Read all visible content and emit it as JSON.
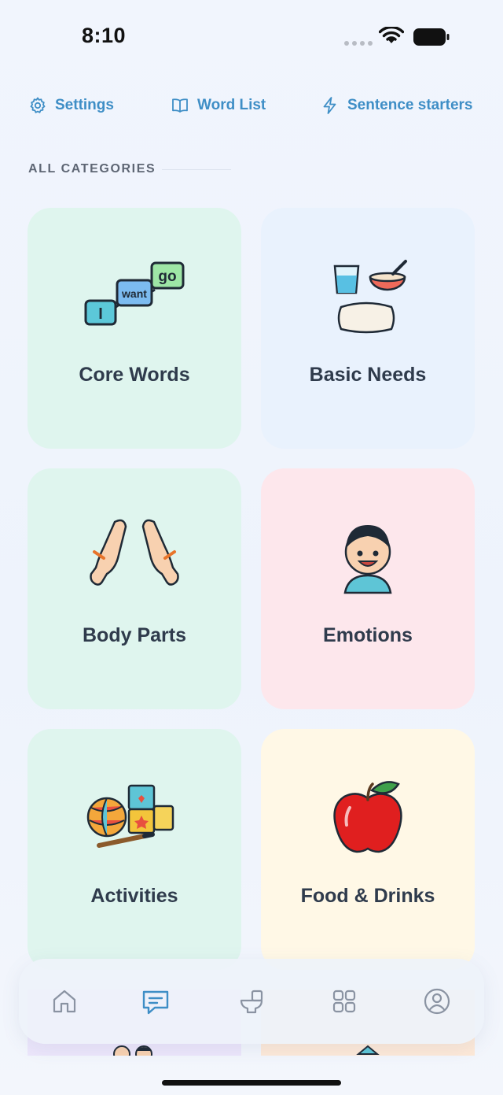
{
  "status": {
    "time": "8:10"
  },
  "toolbar": {
    "settings": {
      "label": "Settings",
      "icon": "gear-icon"
    },
    "word_list": {
      "label": "Word List",
      "icon": "book-icon"
    },
    "sentence_starters": {
      "label": "Sentence starters",
      "icon": "lightning-icon"
    }
  },
  "section": {
    "title": "ALL CATEGORIES"
  },
  "categories": [
    {
      "label": "Core Words",
      "color": "#dff5ee",
      "art_text": [
        "I",
        "want",
        "go"
      ]
    },
    {
      "label": "Basic Needs",
      "color": "#e9f2fd"
    },
    {
      "label": "Body Parts",
      "color": "#dff5ee"
    },
    {
      "label": "Emotions",
      "color": "#fde7ec"
    },
    {
      "label": "Activities",
      "color": "#dff5ee"
    },
    {
      "label": "Food & Drinks",
      "color": "#fff8e6"
    }
  ],
  "tabbar": {
    "tabs": [
      {
        "name": "home",
        "icon": "home-icon",
        "active": false
      },
      {
        "name": "chat",
        "icon": "chat-icon",
        "active": true
      },
      {
        "name": "toilet",
        "icon": "toilet-icon",
        "active": false
      },
      {
        "name": "grid",
        "icon": "grid-icon",
        "active": false
      },
      {
        "name": "profile",
        "icon": "profile-icon",
        "active": false
      }
    ],
    "active_color": "#3e8ec6",
    "inactive_color": "#8a93a2"
  }
}
